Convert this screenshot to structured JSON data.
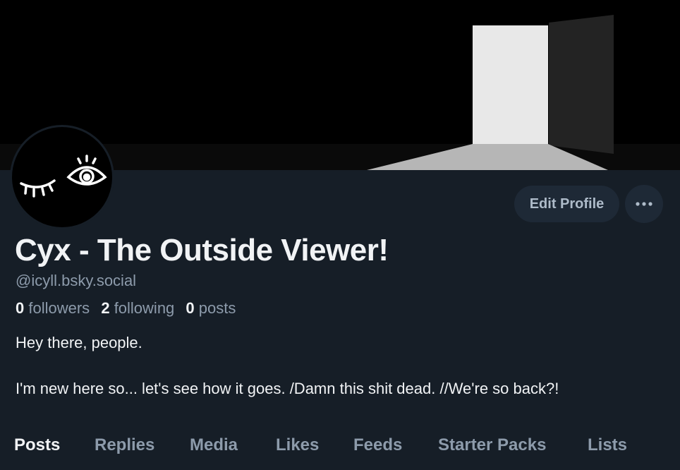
{
  "profile": {
    "display_name": "Cyx - The Outside Viewer!",
    "handle": "@icyll.bsky.social",
    "followers_count": "0",
    "followers_label": "followers",
    "following_count": "2",
    "following_label": "following",
    "posts_count": "0",
    "posts_label": "posts",
    "bio_line1": "Hey there, people.",
    "bio_line2": "I'm new here so... let's see how it goes. /Damn this shit dead. //We're so back?!"
  },
  "actions": {
    "edit_profile_label": "Edit Profile",
    "more_icon": "ellipsis-icon"
  },
  "tabs": [
    {
      "label": "Posts",
      "active": true
    },
    {
      "label": "Replies",
      "active": false
    },
    {
      "label": "Media",
      "active": false
    },
    {
      "label": "Likes",
      "active": false
    },
    {
      "label": "Feeds",
      "active": false
    },
    {
      "label": "Starter Packs",
      "active": false
    },
    {
      "label": "Lists",
      "active": false
    }
  ],
  "colors": {
    "background": "#161e27",
    "button_bg": "#1e2936",
    "text_primary": "#f1f3f5",
    "text_secondary": "#8d9bab"
  }
}
